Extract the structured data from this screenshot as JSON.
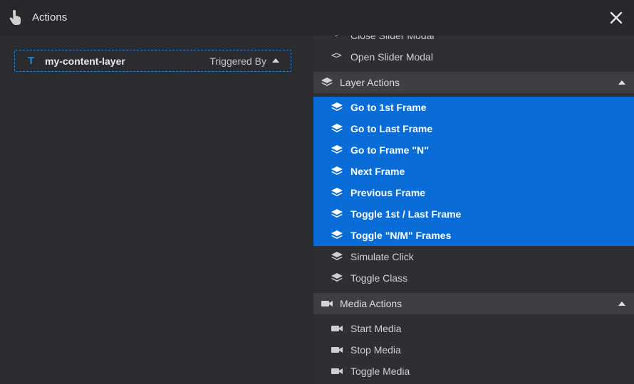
{
  "header": {
    "title": "Actions",
    "hand_icon": "pointer-hand-icon",
    "close_icon": "close-icon"
  },
  "layer": {
    "type_icon_glyph": "T",
    "name": "my-content-layer",
    "triggered_label": "Triggered By"
  },
  "slider_items": [
    {
      "label": "Close Slider Modal",
      "icon": "code-icon"
    },
    {
      "label": "Open Slider Modal",
      "icon": "code-icon"
    }
  ],
  "layer_section": {
    "label": "Layer Actions",
    "icon": "layers-icon"
  },
  "layer_items": [
    {
      "label": "Go to 1st Frame",
      "selected": true
    },
    {
      "label": "Go to Last Frame",
      "selected": true
    },
    {
      "label": "Go to Frame \"N\"",
      "selected": true
    },
    {
      "label": "Next Frame",
      "selected": true
    },
    {
      "label": "Previous Frame",
      "selected": true
    },
    {
      "label": "Toggle 1st / Last Frame",
      "selected": true
    },
    {
      "label": "Toggle \"N/M\" Frames",
      "selected": true
    },
    {
      "label": "Simulate Click",
      "selected": false
    },
    {
      "label": "Toggle Class",
      "selected": false
    }
  ],
  "media_section": {
    "label": "Media Actions",
    "icon": "video-camera-icon"
  },
  "media_items": [
    {
      "label": "Start Media"
    },
    {
      "label": "Stop Media"
    },
    {
      "label": "Toggle Media"
    }
  ],
  "colors": {
    "selected_bg": "#0a6cd6",
    "accent_blue": "#1f82d6",
    "header_bg": "#27282b"
  }
}
